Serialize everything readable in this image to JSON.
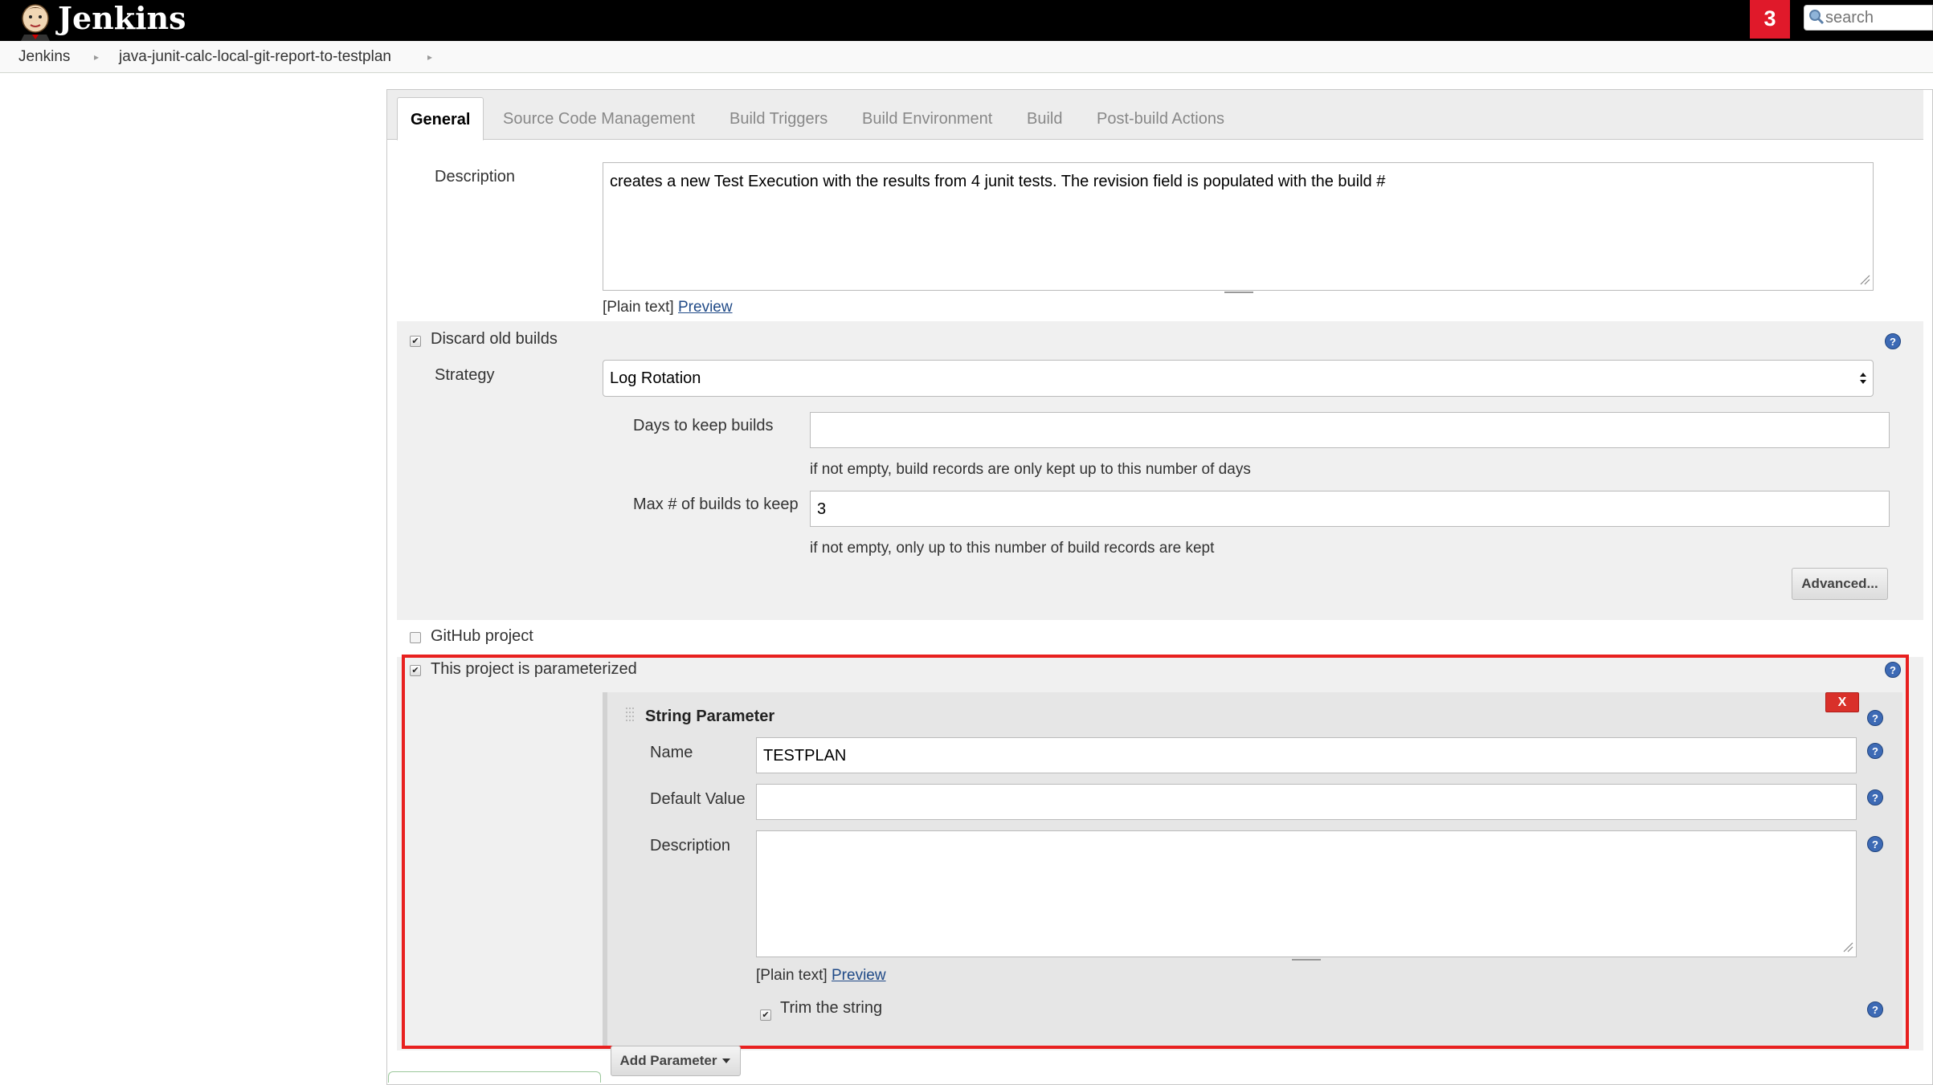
{
  "header": {
    "app_title": "Jenkins",
    "notification_count": "3",
    "search": {
      "placeholder": "search",
      "value": ""
    }
  },
  "breadcrumb": {
    "items": [
      "Jenkins",
      "java-junit-calc-local-git-report-to-testplan"
    ]
  },
  "tabs": [
    {
      "label": "General",
      "active": true
    },
    {
      "label": "Source Code Management",
      "active": false
    },
    {
      "label": "Build Triggers",
      "active": false
    },
    {
      "label": "Build Environment",
      "active": false
    },
    {
      "label": "Build",
      "active": false
    },
    {
      "label": "Post-build Actions",
      "active": false
    }
  ],
  "general": {
    "description": {
      "label": "Description",
      "value": "creates a new Test Execution with the results from 4 junit tests. The revision field is populated with the build #",
      "format_text": "[Plain text]",
      "preview_link": "Preview"
    },
    "discard_old_builds": {
      "label": "Discard old builds",
      "checked": true,
      "strategy_label": "Strategy",
      "strategy_value": "Log Rotation",
      "days_label": "Days to keep builds",
      "days_value": "",
      "days_hint": "if not empty, build records are only kept up to this number of days",
      "max_label": "Max # of builds to keep",
      "max_value": "3",
      "max_hint": "if not empty, only up to this number of build records are kept",
      "advanced_button": "Advanced..."
    },
    "github_project": {
      "label": "GitHub project",
      "checked": false
    },
    "parameterized": {
      "label": "This project is parameterized",
      "checked": true,
      "string_parameter": {
        "title": "String Parameter",
        "delete_button": "X",
        "name_label": "Name",
        "name_value": "TESTPLAN",
        "default_label": "Default Value",
        "default_value": "",
        "description_label": "Description",
        "description_value": "",
        "format_text": "[Plain text]",
        "preview_link": "Preview",
        "trim_label": "Trim the string",
        "trim_checked": true
      },
      "add_parameter_button": "Add Parameter"
    }
  },
  "colors": {
    "header_bg": "#000000",
    "notification_bg": "#e0192a",
    "highlight_box": "#e8201f",
    "link": "#204a87"
  }
}
